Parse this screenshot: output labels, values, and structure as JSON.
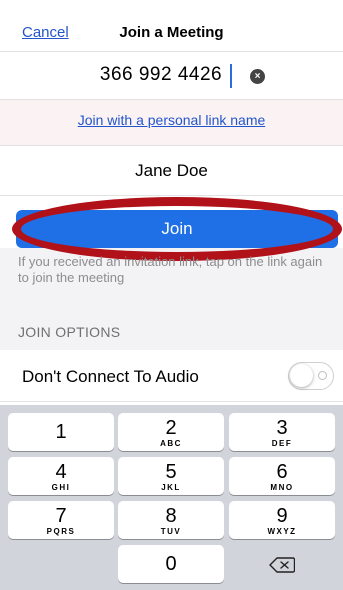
{
  "header": {
    "cancel_label": "Cancel",
    "title": "Join a Meeting"
  },
  "meeting": {
    "id_value": "366 992 4426",
    "clear_icon": "clear-icon"
  },
  "personal_link": {
    "label": "Join with a personal link name"
  },
  "name": {
    "value": "Jane Doe"
  },
  "join": {
    "label": "Join"
  },
  "hint": {
    "text": "If you received an invitation link, tap on the link again to join the meeting"
  },
  "options": {
    "heading": "JOIN OPTIONS",
    "audio_label": "Don't Connect To Audio",
    "audio_toggle_on": false
  },
  "keypad": {
    "keys": [
      {
        "digit": "1",
        "letters": ""
      },
      {
        "digit": "2",
        "letters": "ABC"
      },
      {
        "digit": "3",
        "letters": "DEF"
      },
      {
        "digit": "4",
        "letters": "GHI"
      },
      {
        "digit": "5",
        "letters": "JKL"
      },
      {
        "digit": "6",
        "letters": "MNO"
      },
      {
        "digit": "7",
        "letters": "PQRS"
      },
      {
        "digit": "8",
        "letters": "TUV"
      },
      {
        "digit": "9",
        "letters": "WXYZ"
      },
      {
        "digit": "0",
        "letters": ""
      }
    ],
    "backspace_icon": "backspace-icon"
  },
  "colors": {
    "accent": "#1f6fe6",
    "link": "#2255cc",
    "annotation": "#b1121a"
  }
}
